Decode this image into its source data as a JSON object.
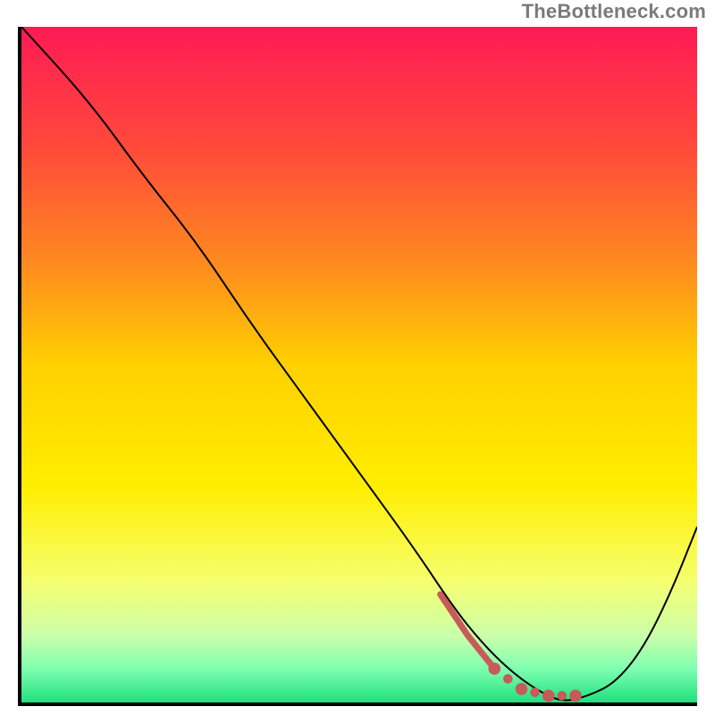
{
  "watermark": "TheBottleneck.com",
  "chart_data": {
    "type": "line",
    "title": "",
    "xlabel": "",
    "ylabel": "",
    "xlim": [
      0,
      100
    ],
    "ylim": [
      0,
      100
    ],
    "gradient_background": {
      "stops": [
        {
          "offset": 0,
          "color": "#ff1a55"
        },
        {
          "offset": 18,
          "color": "#ff4a3a"
        },
        {
          "offset": 35,
          "color": "#ff8a1f"
        },
        {
          "offset": 50,
          "color": "#ffd000"
        },
        {
          "offset": 68,
          "color": "#ffee00"
        },
        {
          "offset": 82,
          "color": "#f6ff6e"
        },
        {
          "offset": 90,
          "color": "#ccffaa"
        },
        {
          "offset": 95,
          "color": "#7fffb0"
        },
        {
          "offset": 100,
          "color": "#1fe07f"
        }
      ]
    },
    "series": [
      {
        "name": "main-curve",
        "color": "#000000",
        "x": [
          0,
          10,
          18,
          26,
          34,
          42,
          50,
          58,
          64,
          68,
          72,
          76,
          80,
          84,
          88,
          92,
          96,
          100
        ],
        "y": [
          100,
          89,
          78,
          68,
          56,
          45,
          34,
          23,
          14,
          9,
          5,
          2,
          0,
          1,
          3,
          8,
          16,
          26
        ]
      },
      {
        "name": "highlight-segment",
        "color": "#c85a5a",
        "style": "thick-with-dots",
        "x": [
          62,
          66,
          70,
          74,
          78,
          82
        ],
        "y": [
          16,
          10,
          5,
          2,
          1,
          1
        ]
      }
    ]
  }
}
